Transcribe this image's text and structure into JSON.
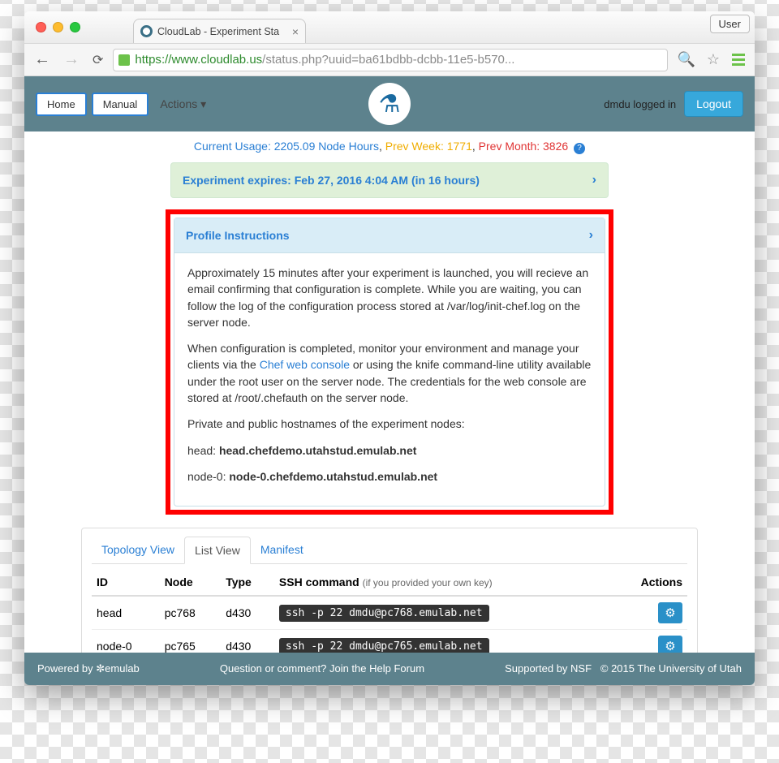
{
  "browser": {
    "tab_title": "CloudLab - Experiment Sta",
    "user_button": "User",
    "url_scheme": "https",
    "url_host": "://www.cloudlab.us",
    "url_path": "/status.php?uuid=ba61bdbb-dcbb-11e5-b570..."
  },
  "header": {
    "home": "Home",
    "manual": "Manual",
    "actions": "Actions",
    "logged_in": "dmdu logged in",
    "logout": "Logout"
  },
  "usage": {
    "prefix": "Current Usage: ",
    "hours": "2205.09 Node Hours",
    "week_label": "Prev Week: 1771",
    "month_label": "Prev Month: 3826"
  },
  "expire": {
    "text": "Experiment expires: Feb 27, 2016 4:04 AM (in 16 hours)"
  },
  "instructions": {
    "title": "Profile Instructions",
    "p1": "Approximately 15 minutes after your experiment is launched, you will recieve an email confirming that configuration is complete. While you are waiting, you can follow the log of the configuration process stored at /var/log/init-chef.log on the server node.",
    "p2a": "When configuration is completed, monitor your environment and manage your clients via the ",
    "p2_link": "Chef web console",
    "p2b": " or using the knife command-line utility available under the root user on the server node. The credentials for the web console are stored at /root/.chefauth on the server node.",
    "p3": "Private and public hostnames of the experiment nodes:",
    "p4a": "head: ",
    "p4b": "head.chefdemo.utahstud.emulab.net",
    "p5a": "node-0: ",
    "p5b": "node-0.chefdemo.utahstud.emulab.net"
  },
  "tabs": {
    "topology": "Topology View",
    "list": "List View",
    "manifest": "Manifest"
  },
  "table": {
    "headers": {
      "id": "ID",
      "node": "Node",
      "type": "Type",
      "ssh": "SSH command ",
      "ssh_sub": "(if you provided your own key)",
      "actions": "Actions"
    },
    "rows": [
      {
        "id": "head",
        "node": "pc768",
        "type": "d430",
        "ssh": "ssh -p 22 dmdu@pc768.emulab.net"
      },
      {
        "id": "node-0",
        "node": "pc765",
        "type": "d430",
        "ssh": "ssh -p 22 dmdu@pc765.emulab.net"
      }
    ]
  },
  "footer": {
    "powered": "Powered by ✼emulab",
    "question": "Question or comment? Join the Help Forum",
    "supported": "Supported by NSF",
    "copyright": "© 2015 The University of Utah"
  }
}
